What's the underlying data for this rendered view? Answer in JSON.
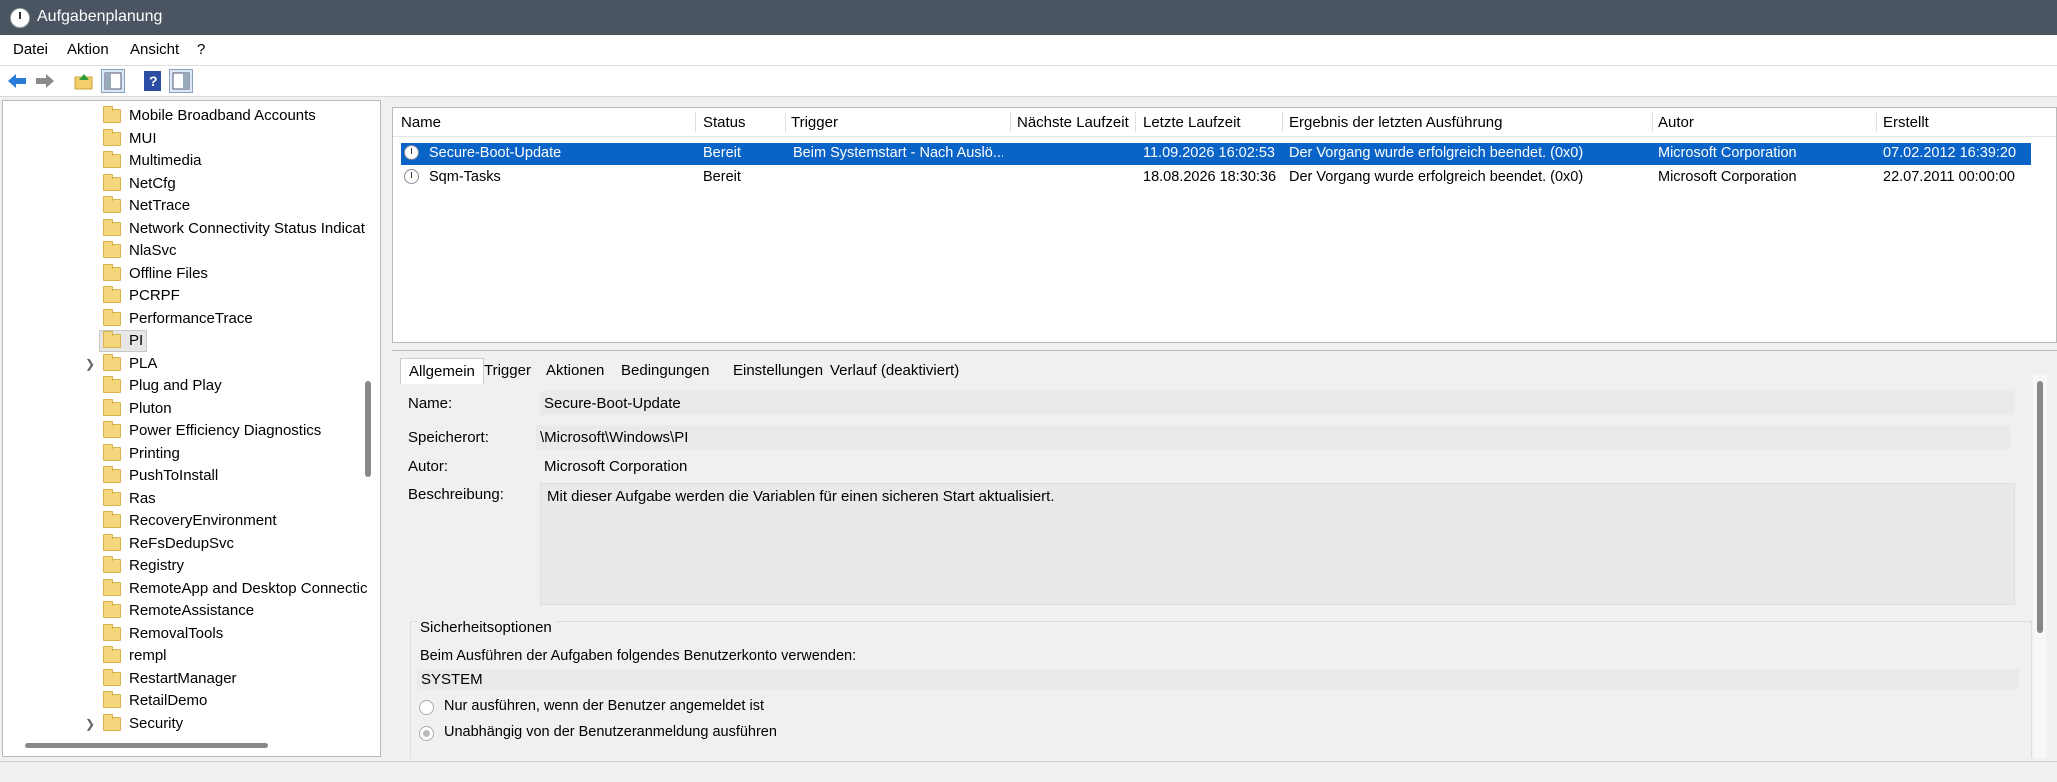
{
  "window": {
    "title": "Aufgabenplanung"
  },
  "menu": [
    "Datei",
    "Aktion",
    "Ansicht",
    "?"
  ],
  "tree": {
    "items": [
      {
        "label": "Mobile Broadband Accounts",
        "expandable": false
      },
      {
        "label": "MUI",
        "expandable": false
      },
      {
        "label": "Multimedia",
        "expandable": false
      },
      {
        "label": "NetCfg",
        "expandable": false
      },
      {
        "label": "NetTrace",
        "expandable": false
      },
      {
        "label": "Network Connectivity Status Indicat",
        "expandable": false
      },
      {
        "label": "NlaSvc",
        "expandable": false
      },
      {
        "label": "Offline Files",
        "expandable": false
      },
      {
        "label": "PCRPF",
        "expandable": false
      },
      {
        "label": "PerformanceTrace",
        "expandable": false
      },
      {
        "label": "PI",
        "expandable": false,
        "selected": true
      },
      {
        "label": "PLA",
        "expandable": true
      },
      {
        "label": "Plug and Play",
        "expandable": false
      },
      {
        "label": "Pluton",
        "expandable": false
      },
      {
        "label": "Power Efficiency Diagnostics",
        "expandable": false
      },
      {
        "label": "Printing",
        "expandable": false
      },
      {
        "label": "PushToInstall",
        "expandable": false
      },
      {
        "label": "Ras",
        "expandable": false
      },
      {
        "label": "RecoveryEnvironment",
        "expandable": false
      },
      {
        "label": "ReFsDedupSvc",
        "expandable": false
      },
      {
        "label": "Registry",
        "expandable": false
      },
      {
        "label": "RemoteApp and Desktop Connectic",
        "expandable": false
      },
      {
        "label": "RemoteAssistance",
        "expandable": false
      },
      {
        "label": "RemovalTools",
        "expandable": false
      },
      {
        "label": "rempl",
        "expandable": false
      },
      {
        "label": "RestartManager",
        "expandable": false
      },
      {
        "label": "RetailDemo",
        "expandable": false
      },
      {
        "label": "Security",
        "expandable": true
      }
    ]
  },
  "tasks": {
    "columns": [
      "Name",
      "Status",
      "Trigger",
      "Nächste Laufzeit",
      "Letzte Laufzeit",
      "Ergebnis der letzten Ausführung",
      "Autor",
      "Erstellt"
    ],
    "rows": [
      {
        "cells": [
          "Secure-Boot-Update",
          "Bereit",
          "Beim Systemstart - Nach Auslö...",
          "",
          "11.09.2026 16:02:53",
          "Der Vorgang wurde erfolgreich beendet. (0x0)",
          "Microsoft Corporation",
          "07.02.2012 16:39:20"
        ],
        "selected": true
      },
      {
        "cells": [
          "Sqm-Tasks",
          "Bereit",
          "",
          "",
          "18.08.2026 18:30:36",
          "Der Vorgang wurde erfolgreich beendet. (0x0)",
          "Microsoft Corporation",
          "22.07.2011 00:00:00"
        ],
        "selected": false
      }
    ]
  },
  "detail": {
    "tabs": [
      "Allgemein",
      "Trigger",
      "Aktionen",
      "Bedingungen",
      "Einstellungen",
      "Verlauf (deaktiviert)"
    ],
    "name_label": "Name:",
    "name_value": "Secure-Boot-Update",
    "location_label": "Speicherort:",
    "location_value": "\\Microsoft\\Windows\\PI",
    "author_label": "Autor:",
    "author_value": "Microsoft Corporation",
    "description_label": "Beschreibung:",
    "description_value": "Mit dieser Aufgabe werden die Variablen für einen sicheren Start aktualisiert.",
    "security": {
      "title": "Sicherheitsoptionen",
      "account_label": "Beim Ausführen der Aufgaben folgendes Benutzerkonto verwenden:",
      "account_value": "SYSTEM",
      "option1": "Nur ausführen, wenn der Benutzer angemeldet ist",
      "option2": "Unabhängig von der Benutzeranmeldung ausführen"
    }
  }
}
